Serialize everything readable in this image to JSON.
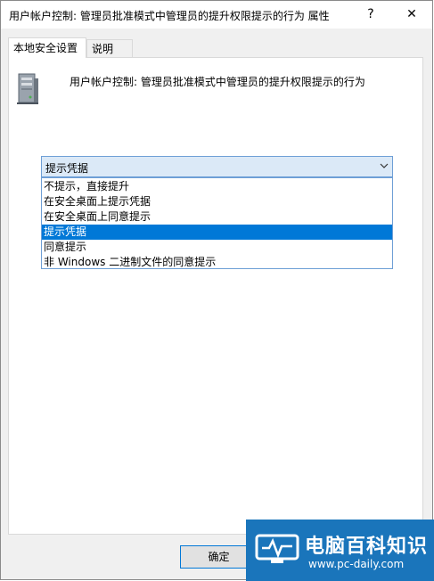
{
  "window": {
    "title": "用户帐户控制: 管理员批准模式中管理员的提升权限提示的行为 属性",
    "help_label": "?",
    "close_label": "✕"
  },
  "tabs": [
    {
      "label": "本地安全设置"
    },
    {
      "label": "说明"
    }
  ],
  "policy": {
    "description": "用户帐户控制: 管理员批准模式中管理员的提升权限提示的行为",
    "icon": "server-icon"
  },
  "combo": {
    "selected": "提示凭据",
    "options": [
      {
        "label": "不提示，直接提升"
      },
      {
        "label": "在安全桌面上提示凭据"
      },
      {
        "label": "在安全桌面上同意提示"
      },
      {
        "label": "提示凭据"
      },
      {
        "label": "同意提示"
      },
      {
        "label": "非 Windows 二进制文件的同意提示"
      }
    ]
  },
  "buttons": {
    "ok": "确定"
  },
  "watermark": {
    "name": "电脑百科知识",
    "url": "www.pc-daily.com"
  },
  "colors": {
    "selection": "#0078d7",
    "watermark_bg": "#1a75bb"
  }
}
